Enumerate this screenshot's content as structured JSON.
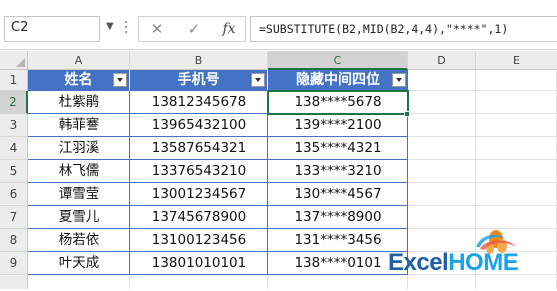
{
  "formula_bar": {
    "name_box": "C2",
    "cancel_icon": "✕",
    "enter_icon": "✓",
    "fx_label": "fx",
    "formula": "=SUBSTITUTE(B2,MID(B2,4,4),\"****\",1)"
  },
  "columns": [
    "A",
    "B",
    "C",
    "D",
    "E"
  ],
  "rows": [
    "1",
    "2",
    "3",
    "4",
    "5",
    "6",
    "7",
    "8",
    "9"
  ],
  "table": {
    "headers": [
      "姓名",
      "手机号",
      "隐藏中间四位"
    ],
    "data": [
      [
        "杜紫鹃",
        "13812345678",
        "138****5678"
      ],
      [
        "韩菲謇",
        "13965432100",
        "139****2100"
      ],
      [
        "江羽溪",
        "13587654321",
        "135****4321"
      ],
      [
        "林飞儒",
        "13376543210",
        "133****3210"
      ],
      [
        "谭雪莹",
        "13001234567",
        "130****4567"
      ],
      [
        "夏雪儿",
        "13745678900",
        "137****8900"
      ],
      [
        "杨若依",
        "13100123456",
        "131****3456"
      ],
      [
        "叶天成",
        "13801010101",
        "138****0101"
      ]
    ]
  },
  "logo": {
    "part1": "Excel",
    "part2": "HOME",
    "color_dark": "#1f5fa8",
    "color_accent": "#1aa3e8",
    "color_orange": "#f08a1c"
  },
  "colors": {
    "header_fill": "#4472c4",
    "selection": "#217346"
  }
}
